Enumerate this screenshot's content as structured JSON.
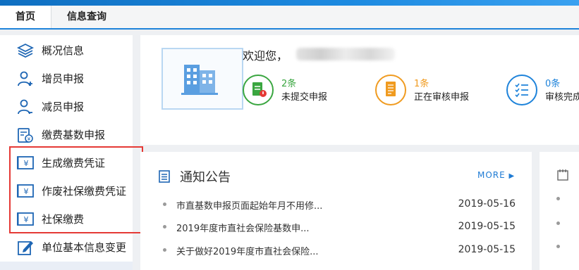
{
  "tabs": {
    "home": "首页",
    "query": "信息查询"
  },
  "sidebar": {
    "items": [
      {
        "label": "概况信息",
        "icon": "layers-icon"
      },
      {
        "label": "增员申报",
        "icon": "user-add-icon"
      },
      {
        "label": "减员申报",
        "icon": "user-remove-icon"
      },
      {
        "label": "缴费基数申报",
        "icon": "fee-base-icon"
      },
      {
        "label": "生成缴费凭证",
        "icon": "yuan-voucher-icon"
      },
      {
        "label": "作废社保缴费凭证",
        "icon": "yuan-voucher-icon"
      },
      {
        "label": "社保缴费",
        "icon": "yuan-voucher-icon"
      },
      {
        "label": "单位基本信息变更",
        "icon": "edit-icon"
      }
    ],
    "highlight_color": "#e53935"
  },
  "welcome": {
    "greeting": "欢迎您，",
    "stats": [
      {
        "count": "2条",
        "label": "未提交申报",
        "color": "#3aa640"
      },
      {
        "count": "1条",
        "label": "正在审核申报",
        "color": "#f09b20"
      },
      {
        "count": "0条",
        "label": "审核完成",
        "color": "#1e83da"
      }
    ]
  },
  "notice": {
    "title": "通知公告",
    "more": "MORE",
    "items": [
      {
        "title": "市直基数申报页面起始年月不用修...",
        "date": "2019-05-16"
      },
      {
        "title": "2019年度市直社会保险基数申...",
        "date": "2019-05-15"
      },
      {
        "title": "关于做好2019年度市直社会保险...",
        "date": "2019-05-15"
      }
    ]
  },
  "colors": {
    "accent": "#1e83da",
    "brand_blue": "#1d8ae0"
  }
}
